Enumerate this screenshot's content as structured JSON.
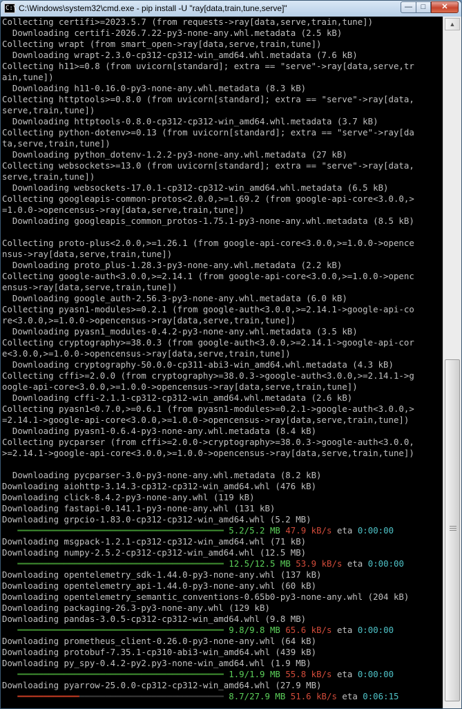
{
  "window": {
    "title": "C:\\Windows\\system32\\cmd.exe - pip  install -U \"ray[data,train,tune,serve]\"",
    "controls": {
      "minimize": "—",
      "maximize": "□",
      "close": "✕"
    },
    "icon_label": "C:\\"
  },
  "console": {
    "lines": [
      "Collecting certifi>=2023.5.7 (from requests->ray[data,serve,train,tune])",
      "  Downloading certifi-2026.7.22-py3-none-any.whl.metadata (2.5 kB)",
      "Collecting wrapt (from smart_open->ray[data,serve,train,tune])",
      "  Downloading wrapt-2.3.0-cp312-cp312-win_amd64.whl.metadata (7.6 kB)",
      "Collecting h11>=0.8 (from uvicorn[standard]; extra == \"serve\"->ray[data,serve,tr",
      "ain,tune])",
      "  Downloading h11-0.16.0-py3-none-any.whl.metadata (8.3 kB)",
      "Collecting httptools>=0.8.0 (from uvicorn[standard]; extra == \"serve\"->ray[data,",
      "serve,train,tune])",
      "  Downloading httptools-0.8.0-cp312-cp312-win_amd64.whl.metadata (3.7 kB)",
      "Collecting python-dotenv>=0.13 (from uvicorn[standard]; extra == \"serve\"->ray[da",
      "ta,serve,train,tune])",
      "  Downloading python_dotenv-1.2.2-py3-none-any.whl.metadata (27 kB)",
      "Collecting websockets>=13.0 (from uvicorn[standard]; extra == \"serve\"->ray[data,",
      "serve,train,tune])",
      "  Downloading websockets-17.0.1-cp312-cp312-win_amd64.whl.metadata (6.5 kB)",
      "Collecting googleapis-common-protos<2.0.0,>=1.69.2 (from google-api-core<3.0.0,>",
      "=1.0.0->opencensus->ray[data,serve,train,tune])",
      "  Downloading googleapis_common_protos-1.75.1-py3-none-any.whl.metadata (8.5 kB)",
      "",
      "Collecting proto-plus<2.0.0,>=1.26.1 (from google-api-core<3.0.0,>=1.0.0->opence",
      "nsus->ray[data,serve,train,tune])",
      "  Downloading proto_plus-1.28.3-py3-none-any.whl.metadata (2.2 kB)",
      "Collecting google-auth<3.0.0,>=2.14.1 (from google-api-core<3.0.0,>=1.0.0->openc",
      "ensus->ray[data,serve,train,tune])",
      "  Downloading google_auth-2.56.3-py3-none-any.whl.metadata (6.0 kB)",
      "Collecting pyasn1-modules>=0.2.1 (from google-auth<3.0.0,>=2.14.1->google-api-co",
      "re<3.0.0,>=1.0.0->opencensus->ray[data,serve,train,tune])",
      "  Downloading pyasn1_modules-0.4.2-py3-none-any.whl.metadata (3.5 kB)",
      "Collecting cryptography>=38.0.3 (from google-auth<3.0.0,>=2.14.1->google-api-cor",
      "e<3.0.0,>=1.0.0->opencensus->ray[data,serve,train,tune])",
      "  Downloading cryptography-50.0.0-cp311-abi3-win_amd64.whl.metadata (4.3 kB)",
      "Collecting cffi>=2.0.0 (from cryptography>=38.0.3->google-auth<3.0.0,>=2.14.1->g",
      "oogle-api-core<3.0.0,>=1.0.0->opencensus->ray[data,serve,train,tune])",
      "  Downloading cffi-2.1.1-cp312-cp312-win_amd64.whl.metadata (2.6 kB)",
      "Collecting pyasn1<0.7.0,>=0.6.1 (from pyasn1-modules>=0.2.1->google-auth<3.0.0,>",
      "=2.14.1->google-api-core<3.0.0,>=1.0.0->opencensus->ray[data,serve,train,tune])",
      "  Downloading pyasn1-0.6.4-py3-none-any.whl.metadata (8.4 kB)",
      "Collecting pycparser (from cffi>=2.0.0->cryptography>=38.0.3->google-auth<3.0.0,",
      ">=2.14.1->google-api-core<3.0.0,>=1.0.0->opencensus->ray[data,serve,train,tune])",
      "",
      "  Downloading pycparser-3.0-py3-none-any.whl.metadata (8.2 kB)",
      "Downloading aiohttp-3.14.3-cp312-cp312-win_amd64.whl (476 kB)",
      "Downloading click-8.4.2-py3-none-any.whl (119 kB)",
      "Downloading fastapi-0.141.1-py3-none-any.whl (131 kB)",
      "Downloading grpcio-1.83.0-cp312-cp312-win_amd64.whl (5.2 MB)",
      {
        "progress": {
          "done": 40,
          "todo": 0,
          "amount": "5.2/5.2 MB",
          "speed": "47.9 kB/s",
          "eta_label": "eta",
          "eta": "0:00:00"
        }
      },
      "Downloading msgpack-1.2.1-cp312-cp312-win_amd64.whl (71 kB)",
      "Downloading numpy-2.5.2-cp312-cp312-win_amd64.whl (12.5 MB)",
      {
        "progress": {
          "done": 40,
          "todo": 0,
          "amount": "12.5/12.5 MB",
          "speed": "53.9 kB/s",
          "eta_label": "eta",
          "eta": "0:00:00"
        }
      },
      "Downloading opentelemetry_sdk-1.44.0-py3-none-any.whl (137 kB)",
      "Downloading opentelemetry_api-1.44.0-py3-none-any.whl (60 kB)",
      "Downloading opentelemetry_semantic_conventions-0.65b0-py3-none-any.whl (204 kB)",
      "Downloading packaging-26.3-py3-none-any.whl (129 kB)",
      "Downloading pandas-3.0.5-cp312-cp312-win_amd64.whl (9.8 MB)",
      {
        "progress": {
          "done": 40,
          "todo": 0,
          "amount": "9.8/9.8 MB",
          "speed": "65.6 kB/s",
          "eta_label": "eta",
          "eta": "0:00:00"
        }
      },
      "Downloading prometheus_client-0.26.0-py3-none-any.whl (64 kB)",
      "Downloading protobuf-7.35.1-cp310-abi3-win_amd64.whl (439 kB)",
      "Downloading py_spy-0.4.2-py2.py3-none-win_amd64.whl (1.9 MB)",
      {
        "progress": {
          "done": 40,
          "todo": 0,
          "amount": "1.9/1.9 MB",
          "speed": "55.8 kB/s",
          "eta_label": "eta",
          "eta": "0:00:00"
        }
      },
      "Downloading pyarrow-25.0.0-cp312-cp312-win_amd64.whl (27.9 MB)",
      {
        "progress": {
          "done": 12,
          "todo": 28,
          "partial": true,
          "amount": "8.7/27.9 MB",
          "speed": "51.6 kB/s",
          "eta_label": "eta",
          "eta": "0:06:15"
        }
      }
    ]
  },
  "scrollbar": {
    "up_arrow": "▲"
  }
}
